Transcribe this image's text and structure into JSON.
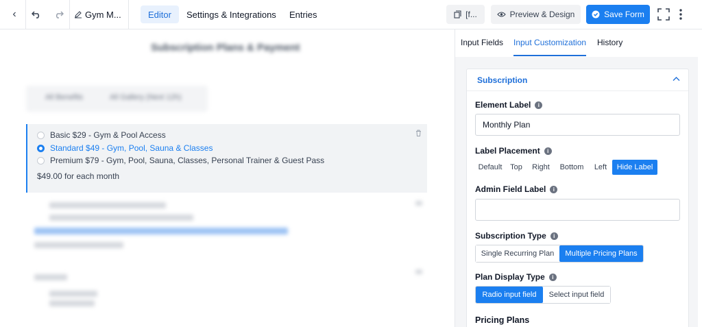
{
  "topbar": {
    "form_name": "Gym M...",
    "tabs": [
      "Editor",
      "Settings & Integrations",
      "Entries"
    ],
    "shortcode_label": "[f...",
    "preview_label": "Preview & Design",
    "save_label": "Save Form"
  },
  "canvas": {
    "blurred_title": "Subscription Plans & Payment",
    "blurred_pill_1": "All Benefits",
    "blurred_pill_2": "All Gallery (Next 12h)",
    "subscription_options": [
      "Basic $29 - Gym & Pool Access",
      "Standard $49 - Gym, Pool, Sauna & Classes",
      "Premium $79 - Gym, Pool, Sauna, Classes, Personal Trainer & Guest Pass"
    ],
    "selected_index": 1,
    "price_text": "$49.00 for each month"
  },
  "panel": {
    "tabs": [
      "Input Fields",
      "Input Customization",
      "History"
    ],
    "section_title": "Subscription",
    "element_label": "Element Label",
    "element_label_value": "Monthly Plan",
    "label_placement": "Label Placement",
    "placement_options": [
      "Default",
      "Top",
      "Right",
      "Bottom",
      "Left",
      "Hide Label"
    ],
    "admin_field_label": "Admin Field Label",
    "admin_field_value": "",
    "subscription_type": "Subscription Type",
    "subscription_type_options": [
      "Single Recurring Plan",
      "Multiple Pricing Plans"
    ],
    "plan_display_type": "Plan Display Type",
    "plan_display_options": [
      "Radio input field",
      "Select input field"
    ],
    "pricing_plans": "Pricing Plans"
  },
  "colors": {
    "accent": "#1b7ff0",
    "active_tab_bg": "#e8f1fd"
  }
}
